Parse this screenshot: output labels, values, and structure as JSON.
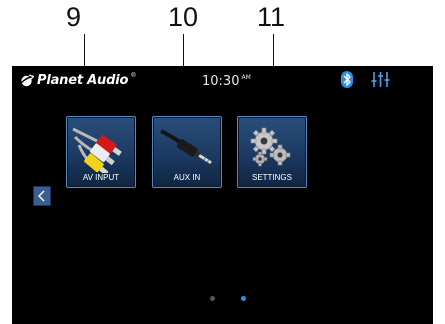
{
  "callouts": [
    "9",
    "10",
    "11"
  ],
  "status_bar": {
    "logo_text": "Planet Audio",
    "logo_mark": "®",
    "time": "10:30",
    "ampm": "AM",
    "bluetooth_icon": "bluetooth-icon",
    "equalizer_icon": "equalizer-icon"
  },
  "tiles": [
    {
      "label": "AV INPUT",
      "icon": "rca-cables-icon"
    },
    {
      "label": "AUX IN",
      "icon": "aux-jack-icon"
    },
    {
      "label": "SETTINGS",
      "icon": "gears-icon"
    }
  ],
  "nav": {
    "previous_icon": "chevron-left-icon"
  },
  "pagination": {
    "pages": 2,
    "current": 2
  },
  "colors": {
    "screen_bg": "#000000",
    "tile_bg": "#1c3a62",
    "tile_border": "#5b86b8",
    "bluetooth": "#2f8fe0",
    "equalizer": "#4aa0e8",
    "page_dot_active": "#2f8fe0",
    "page_dot_inactive": "#555555"
  }
}
